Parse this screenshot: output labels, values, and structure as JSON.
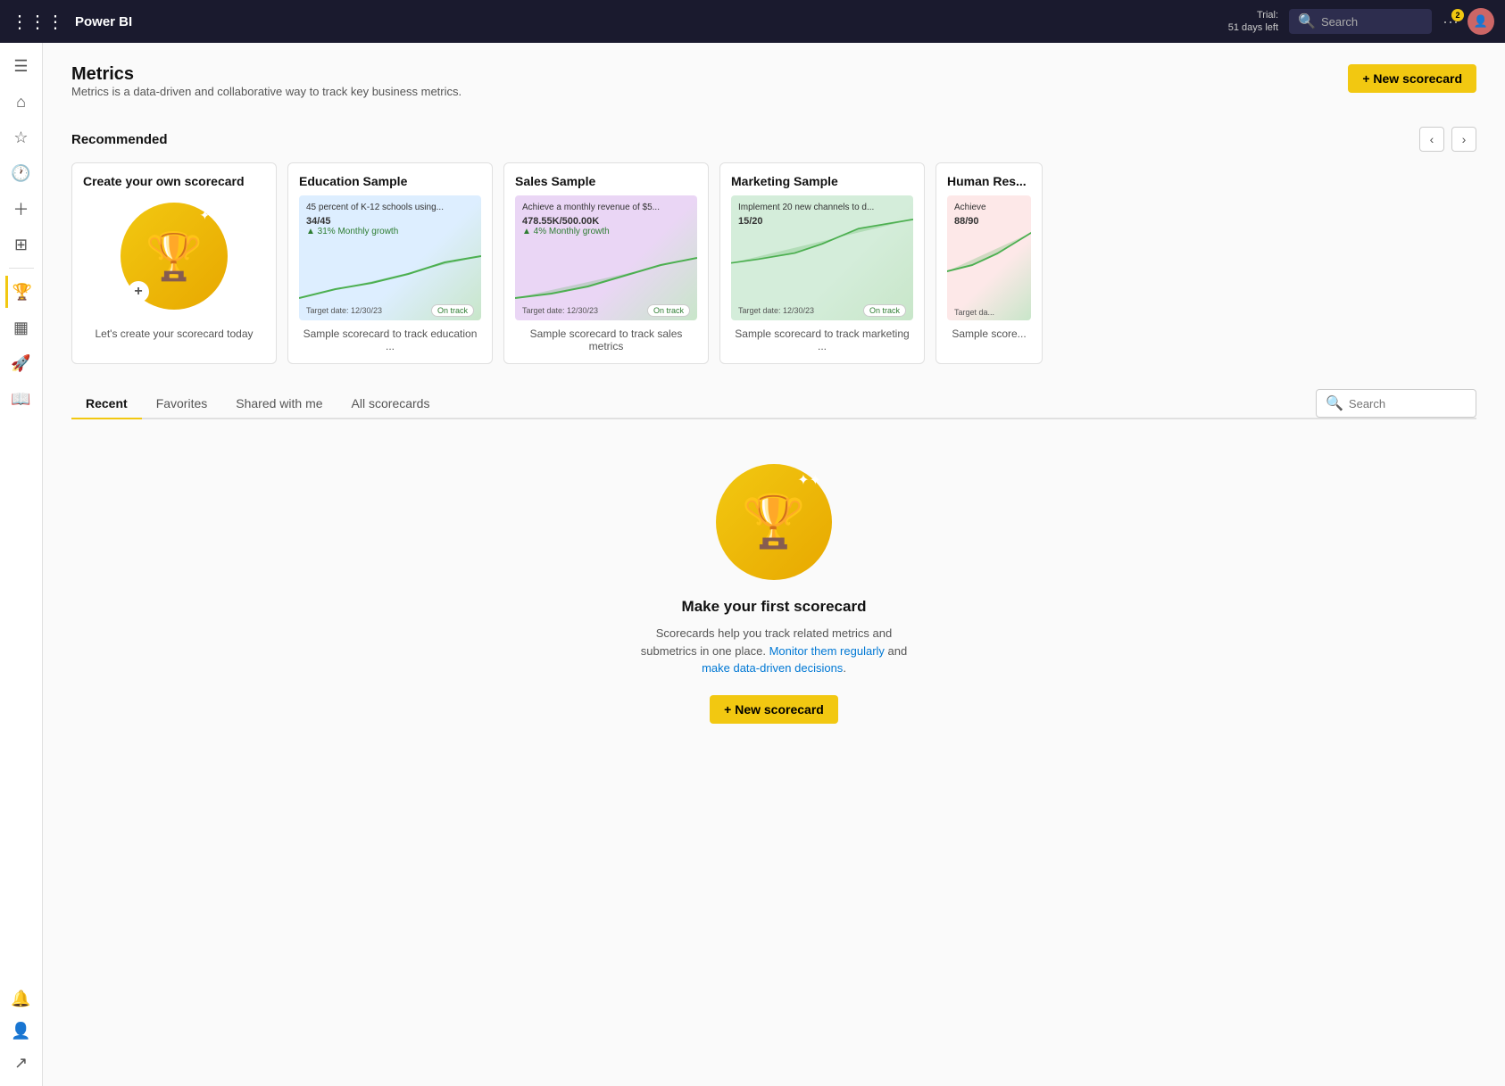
{
  "topnav": {
    "logo": "Power BI",
    "trial_line1": "Trial:",
    "trial_line2": "51 days left",
    "search_placeholder": "Search",
    "notif_count": "2"
  },
  "sidebar": {
    "items": [
      {
        "id": "menu",
        "icon": "☰",
        "label": "Menu"
      },
      {
        "id": "home",
        "icon": "⌂",
        "label": "Home"
      },
      {
        "id": "favorites",
        "icon": "☆",
        "label": "Favorites"
      },
      {
        "id": "recent",
        "icon": "🕐",
        "label": "Recent"
      },
      {
        "id": "create",
        "icon": "+",
        "label": "Create"
      },
      {
        "id": "browse",
        "icon": "⊞",
        "label": "Browse"
      },
      {
        "id": "metrics",
        "icon": "🏆",
        "label": "Metrics",
        "active": true
      },
      {
        "id": "apps",
        "icon": "⚙",
        "label": "Apps"
      },
      {
        "id": "learn",
        "icon": "🚀",
        "label": "Learn"
      },
      {
        "id": "book",
        "icon": "📖",
        "label": "Book"
      }
    ],
    "bottom_items": [
      {
        "id": "notifications",
        "icon": "🔔",
        "label": "Notifications"
      },
      {
        "id": "avatar",
        "icon": "👤",
        "label": "User Avatar"
      },
      {
        "id": "expand",
        "icon": "↗",
        "label": "Expand"
      }
    ]
  },
  "page": {
    "title": "Metrics",
    "subtitle": "Metrics is a data-driven and collaborative way to track key business metrics."
  },
  "new_scorecard_button": "+ New scorecard",
  "recommended": {
    "section_title": "Recommended",
    "cards": [
      {
        "id": "create-own",
        "title": "Create your own scorecard",
        "desc": "Let's create your scorecard today",
        "type": "create"
      },
      {
        "id": "education",
        "title": "Education Sample",
        "type": "sample",
        "theme": "blue",
        "metric_text": "45 percent of K-12 schools using...",
        "metric_value": "34/45",
        "growth": "31% Monthly growth",
        "target_date": "Target date: 12/30/23",
        "status": "On track",
        "desc": "Sample scorecard to track education ..."
      },
      {
        "id": "sales",
        "title": "Sales Sample",
        "type": "sample",
        "theme": "purple",
        "metric_text": "Achieve a monthly revenue of $5...",
        "metric_value": "478.55K/500.00K",
        "growth": "4% Monthly growth",
        "target_date": "Target date: 12/30/23",
        "status": "On track",
        "desc": "Sample scorecard to track sales metrics"
      },
      {
        "id": "marketing",
        "title": "Marketing Sample",
        "type": "sample",
        "theme": "green",
        "metric_text": "Implement 20 new channels to d...",
        "metric_value": "15/20",
        "growth": "",
        "target_date": "Target date: 12/30/23",
        "status": "On track",
        "desc": "Sample scorecard to track marketing ..."
      },
      {
        "id": "human-res",
        "title": "Human Res...",
        "type": "sample",
        "theme": "pink",
        "metric_text": "Achieve",
        "metric_value": "88/90",
        "growth": "",
        "target_date": "Target da...",
        "status": "",
        "desc": "Sample score..."
      }
    ]
  },
  "tabs": {
    "items": [
      {
        "id": "recent",
        "label": "Recent",
        "active": true
      },
      {
        "id": "favorites",
        "label": "Favorites",
        "active": false
      },
      {
        "id": "shared",
        "label": "Shared with me",
        "active": false
      },
      {
        "id": "all",
        "label": "All scorecards",
        "active": false
      }
    ],
    "search_placeholder": "Search"
  },
  "empty_state": {
    "title": "Make your first scorecard",
    "desc_part1": "Scorecards help you track related metrics and submetrics in one place. Monitor them regularly and make data-driven decisions.",
    "link1": "Monitor them regularly",
    "link2": "make data-driven decisions",
    "button": "+ New scorecard"
  }
}
